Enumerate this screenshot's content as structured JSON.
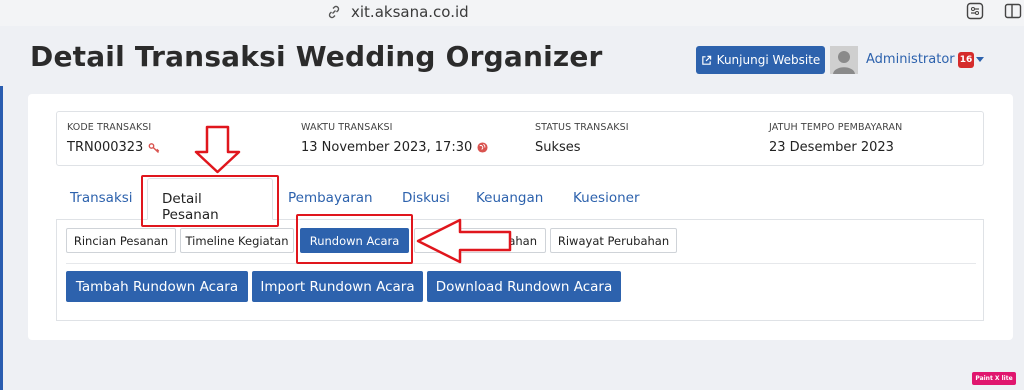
{
  "browser": {
    "url": "xit.aksana.co.id",
    "link_icon": "link-icon",
    "settings_icon": "settings-icon",
    "sidebar_icon": "sidebar-icon"
  },
  "header": {
    "title": "Detail Transaksi Wedding Organizer",
    "visit_button": "Kunjungi Website",
    "user_name": "Administrator",
    "notification_count": "16"
  },
  "info": [
    {
      "label": "KODE TRANSAKSI",
      "value": "TRN000323"
    },
    {
      "label": "WAKTU TRANSAKSI",
      "value": "13 November 2023, 17:30"
    },
    {
      "label": "STATUS TRANSAKSI",
      "value": "Sukses"
    },
    {
      "label": "JATUH TEMPO PEMBAYARAN",
      "value": "23 Desember 2023"
    }
  ],
  "tabs": [
    "Transaksi",
    "Detail Pesanan",
    "Pembayaran",
    "Diskusi",
    "Keuangan",
    "Kuesioner"
  ],
  "sub_tabs": [
    "Rincian Pesanan",
    "Timeline Kegiatan",
    "Rundown Acara",
    "ahan",
    "Riwayat Perubahan"
  ],
  "actions": [
    "Tambah Rundown Acara",
    "Import Rundown Acara",
    "Download Rundown Acara"
  ],
  "watermark": "Paint X lite",
  "colors": {
    "primary": "#2d62ad",
    "annotation": "#e0161d",
    "badge": "#d52b2b"
  }
}
